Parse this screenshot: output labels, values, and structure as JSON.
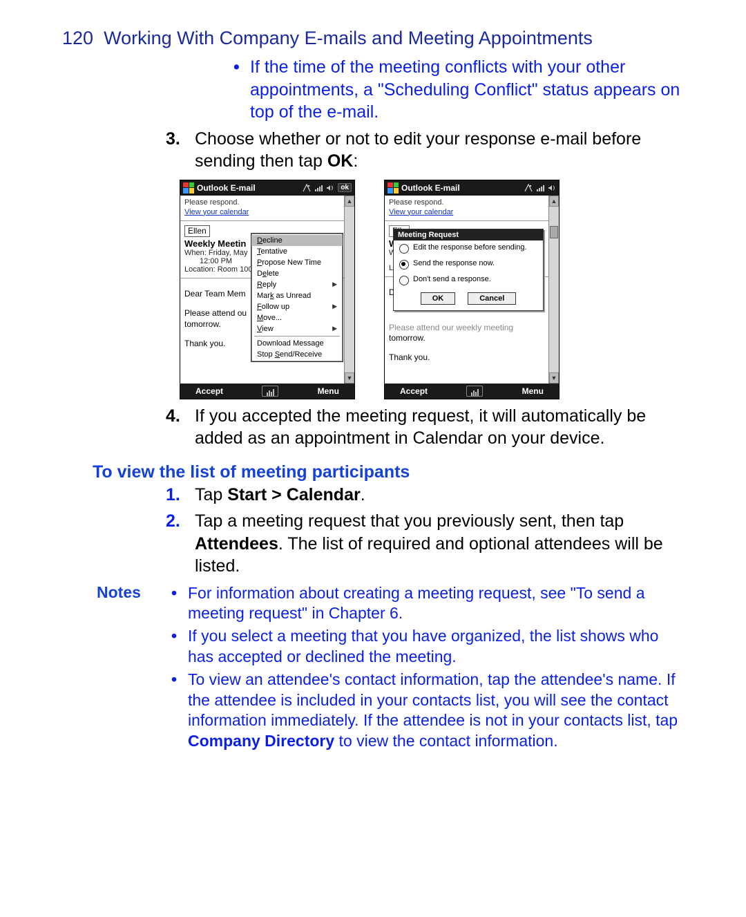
{
  "header": {
    "page_no": "120",
    "title": "Working With Company E-mails and Meeting Appointments"
  },
  "top_bullet": "If the time of the meeting conflicts with your other appointments, a \"Scheduling Conflict\" status appears on top of the e-mail.",
  "step3": {
    "marker": "3.",
    "text_a": "Choose whether or not to edit your response e-mail before sending then tap ",
    "bold": "OK",
    "text_b": ":"
  },
  "shots": {
    "titlebar_app": "Outlook E-mail",
    "ok_label": "ok",
    "please_respond": "Please respond.",
    "view_calendar": "View your calendar",
    "from": "Ellen",
    "subject": "Weekly Meetin",
    "when_a": "When: Friday, May",
    "when_b": "12:00 PM",
    "location": "Location: Room 100",
    "body1": "Dear Team Mem",
    "body2": "Please attend ou",
    "body3": "tomorrow.",
    "body4": "Thank you.",
    "sk_left": "Accept",
    "sk_right": "Menu",
    "menu": {
      "decline": "Decline",
      "tentative": "Tentative",
      "propose": "Propose New Time",
      "delete": "Delete",
      "reply": "Reply",
      "mark_unread": "Mark as Unread",
      "follow_up": "Follow up",
      "move": "Move...",
      "view": "View",
      "download": "Download Message",
      "stop": "Stop Send/Receive"
    },
    "shot2": {
      "from_clip": "Elle",
      "subject_clip": "We",
      "when_clip": "Wh",
      "loc_clip": "Loc",
      "body1_clip": "De",
      "behind": "Please attend our weekly meeting",
      "dialog_title": "Meeting Request",
      "opt1": "Edit the response before sending.",
      "opt2": "Send the response now.",
      "opt3": "Don't send a response.",
      "ok": "OK",
      "cancel": "Cancel"
    }
  },
  "step4": {
    "marker": "4.",
    "text": "If you accepted the meeting request, it will automatically be added as an appointment in Calendar on your device."
  },
  "section_heading": "To view the list of meeting participants",
  "p1": {
    "marker": "1.",
    "a": "Tap ",
    "bold": "Start > Calendar",
    "b": "."
  },
  "p2": {
    "marker": "2.",
    "a": "Tap a meeting request that you previously sent, then tap ",
    "bold": "Attendees",
    "b": ". The list of required and optional attendees will be listed."
  },
  "notes_label": "Notes",
  "note1": "For information about creating a meeting request, see \"To send a meeting request\" in Chapter 6.",
  "note2": "If you select a meeting that you have organized, the list shows who has accepted or declined the meeting.",
  "note3_a": "To view an attendee's contact information, tap the attendee's name. If the attendee is included in your contacts list, you will see the contact information immediately. If the attendee is not in your contacts list, tap ",
  "note3_bold": "Company Directory",
  "note3_b": " to view the contact information."
}
